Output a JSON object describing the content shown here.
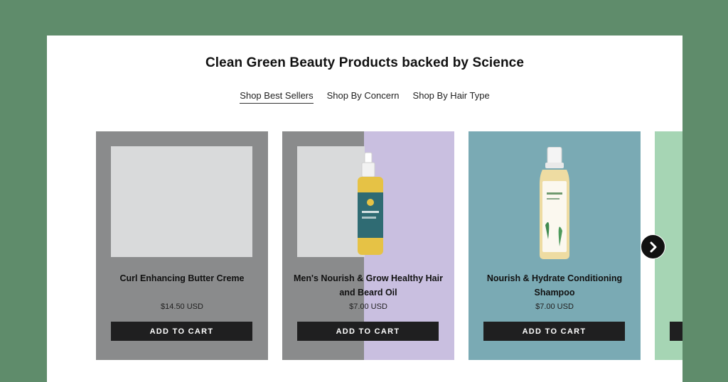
{
  "section": {
    "title": "Clean Green Beauty Products backed by Science"
  },
  "tabs": [
    {
      "label": "Shop Best Sellers",
      "active": true
    },
    {
      "label": "Shop By Concern",
      "active": false
    },
    {
      "label": "Shop By Hair Type",
      "active": false
    }
  ],
  "products": [
    {
      "name": "Curl Enhancing Butter Creme",
      "price": "$14.50 USD",
      "button": "ADD TO CART",
      "background": "#8a8b8c"
    },
    {
      "name": "Men's Nourish & Grow Healthy Hair and Beard Oil",
      "price": "$7.00 USD",
      "button": "ADD TO CART",
      "background": "#8a8b8c"
    },
    {
      "name": "Nourish & Hydrate Conditioning Shampoo",
      "price": "$7.00 USD",
      "button": "ADD TO CART",
      "background": "#7aaab4"
    },
    {
      "name": "",
      "price": "",
      "button": "",
      "background": "#a6d5b4"
    }
  ],
  "navigation": {
    "next_icon": "chevron-right-icon"
  },
  "colors": {
    "page_background": "#5f8c6b",
    "card_gray": "#8a8b8c",
    "card_lavender": "#c9bfe0",
    "card_teal": "#7aaab4",
    "card_mint": "#a6d5b4",
    "button": "#1f1f20"
  }
}
